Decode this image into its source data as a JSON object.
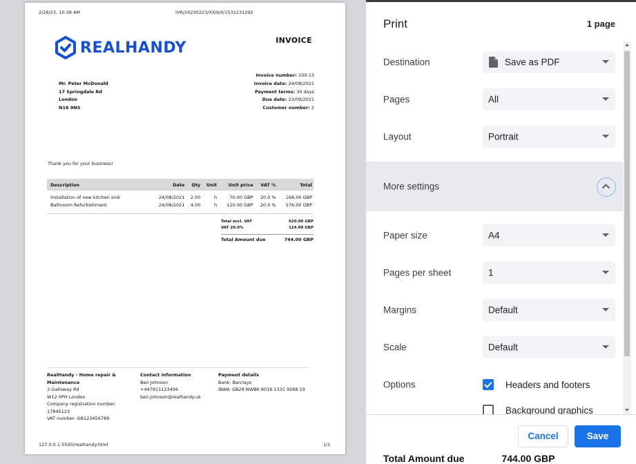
{
  "invoice": {
    "header_left": "2/26/23, 10:38 AM",
    "header_center": "IVR/20230223/XXIII/II/1532231292",
    "brand": "REALHANDY",
    "title": "INVOICE",
    "address": [
      "Mr. Peter McDonald",
      "17 Springdale Rd",
      "London",
      "N16 9NS"
    ],
    "meta": [
      {
        "label": "Invoice number:",
        "value": "100-13"
      },
      {
        "label": "Invoice date:",
        "value": "24/08/2021"
      },
      {
        "label": "Payment terms:",
        "value": "30 days"
      },
      {
        "label": "Due date:",
        "value": "23/09/2021"
      },
      {
        "label": "Customer number:",
        "value": "2"
      }
    ],
    "thanks": "Thank you for your business!",
    "columns": [
      "Description",
      "Date",
      "Qty",
      "Unit",
      "Unit price",
      "VAT %",
      "Total"
    ],
    "rows": [
      [
        "Installation of new kitchen sink",
        "24/08/2021",
        "2.00",
        "h",
        "70.00 GBP",
        "20.0 %",
        "168.00 GBP"
      ],
      [
        "Bathroom Refurbishment",
        "24/08/2021",
        "4.00",
        "h",
        "120.00 GBP",
        "20.0 %",
        "576.00 GBP"
      ]
    ],
    "totals": [
      {
        "label": "Total excl. VAT",
        "value": "620.00 GBP"
      },
      {
        "label": "VAT 20.0%",
        "value": "124.00 GBP"
      }
    ],
    "grand_total": {
      "label": "Total Amount due",
      "value": "744.00 GBP"
    },
    "footer": {
      "company_heading": "RealHandy - Home repair & Maintenance",
      "company_lines": [
        "3 Galloway Rd",
        "W12 0PH London",
        "Company registration number:",
        "17845123",
        "VAT number: GB123456789"
      ],
      "contact_heading": "Contact information",
      "contact_lines": [
        "Ben Johnson",
        "+447911123456",
        "ben.johnson@realhandy.uk"
      ],
      "payment_heading": "Payment details",
      "payment_lines": [
        "Bank: Barclays",
        "IBAN: GB29 NWBK 6016 1331 9268 19"
      ]
    },
    "footer_url": "127.0.0.1:5500/realhandy.html",
    "page_num": "1/1"
  },
  "print": {
    "title": "Print",
    "page_count": "1 page",
    "destination": {
      "label": "Destination",
      "value": "Save as PDF",
      "icon": "document-icon"
    },
    "pages": {
      "label": "Pages",
      "value": "All"
    },
    "layout": {
      "label": "Layout",
      "value": "Portrait"
    },
    "more_settings": {
      "label": "More settings",
      "icon": "chevron-up-icon"
    },
    "paper_size": {
      "label": "Paper size",
      "value": "A4"
    },
    "pages_per_sheet": {
      "label": "Pages per sheet",
      "value": "1"
    },
    "margins": {
      "label": "Margins",
      "value": "Default"
    },
    "scale": {
      "label": "Scale",
      "value": "Default"
    },
    "options": {
      "label": "Options",
      "headers_footers": {
        "label": "Headers and footers",
        "checked": true
      },
      "background_graphics": {
        "label": "Background graphics",
        "checked": false
      }
    },
    "cancel_label": "Cancel",
    "save_label": "Save",
    "accent_color": "#1a73e8"
  },
  "bleed_through": {
    "label": "Total Amount due",
    "value": "744.00 GBP"
  }
}
